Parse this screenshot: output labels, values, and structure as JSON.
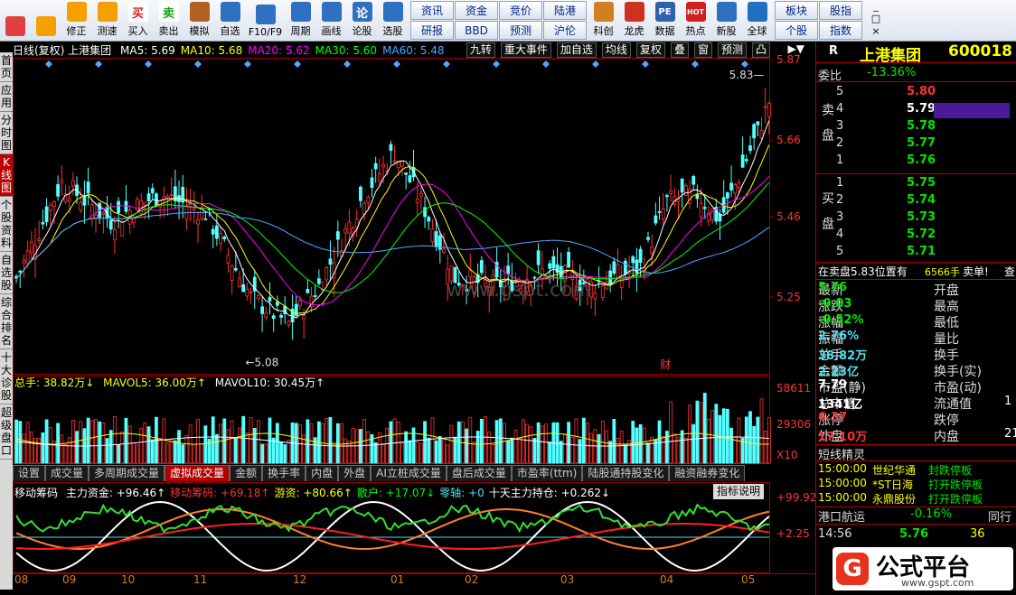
{
  "toolbar": {
    "buttons": [
      {
        "label": "",
        "icon": "grid-icon"
      },
      {
        "label": "",
        "icon": "back-arrow-icon"
      },
      {
        "label": "修正",
        "icon": "arrow-updown-icon"
      },
      {
        "label": "测速",
        "icon": "speed-icon"
      },
      {
        "label": "买入",
        "icon": "buy-icon",
        "glyph": "买"
      },
      {
        "label": "卖出",
        "icon": "sell-icon",
        "glyph": "卖"
      },
      {
        "label": "模拟",
        "icon": "hammer-icon"
      },
      {
        "label": "自选",
        "icon": "folder-icon"
      },
      {
        "label": "F10/F9",
        "icon": "f10-icon"
      },
      {
        "label": "周期",
        "icon": "clock-icon"
      },
      {
        "label": "画线",
        "icon": "pen-icon"
      },
      {
        "label": "论股",
        "icon": "talk-icon",
        "glyph": "论"
      },
      {
        "label": "选股",
        "icon": "search-chart-icon"
      }
    ],
    "grid": [
      [
        "资讯",
        "资金",
        "竞价",
        "陆港"
      ],
      [
        "研报",
        "BBD",
        "预测",
        "沪伦"
      ]
    ],
    "buttons2": [
      {
        "label": "科创",
        "icon": "star-chart-icon"
      },
      {
        "label": "龙虎",
        "icon": "dragon-icon"
      },
      {
        "label": "数据",
        "icon": "pe-icon",
        "glyph": "PE"
      },
      {
        "label": "热点",
        "icon": "hot-icon",
        "glyph": "HOT"
      },
      {
        "label": "新股",
        "icon": "new-stock-icon"
      },
      {
        "label": "全球",
        "icon": "globe-icon"
      }
    ],
    "grid2": [
      [
        "板块",
        "股指"
      ],
      [
        "个股",
        "指数"
      ]
    ],
    "window": [
      "_",
      "□",
      "×"
    ]
  },
  "left_tabs": [
    "首页",
    "应用",
    "分时图",
    "K线图",
    "个股资料",
    "自选股",
    "综合排名",
    "十大诊股",
    "超级盘口"
  ],
  "info": {
    "title": "日线(复权) 上港集团",
    "ma": [
      {
        "label": "MA5: 5.69",
        "color": "#ffffff"
      },
      {
        "label": "MA10: 5.68",
        "color": "#ffff00"
      },
      {
        "label": "MA20: 5.62",
        "color": "#ff00ff"
      },
      {
        "label": "MA30: 5.60",
        "color": "#00ff00"
      },
      {
        "label": "MA60: 5.48",
        "color": "#4ea8ff"
      }
    ],
    "buttons": [
      "九转",
      "重大事件",
      "加自选",
      "均线",
      "复权",
      "叠",
      "窗",
      "预测",
      "凸"
    ],
    "arrows": "▶▼"
  },
  "chart_data": {
    "type": "candlestick",
    "price_axis": [
      "5.87",
      "5.66",
      "5.46",
      "5.25"
    ],
    "price_range": [
      5.05,
      5.87
    ],
    "annotations": {
      "high": "5.83",
      "low": "5.08",
      "event": "财"
    },
    "volume_axis": [
      "58611",
      "29306",
      "X10"
    ],
    "indicator_axis": [
      "+99.92",
      "+2.25"
    ],
    "months": [
      "08",
      "09",
      "10",
      "11",
      "12",
      "01",
      "02",
      "03",
      "04",
      "05"
    ]
  },
  "volume": {
    "label": "总手: 38.82万↓",
    "mavol5": "MAVOL5: 36.00万↑",
    "mavol10": "MAVOL10: 30.45万↑"
  },
  "bottom_tabs": [
    "设置",
    "成交量",
    "多周期成交量",
    "虚拟成交量",
    "金额",
    "换手率",
    "内盘",
    "外盘",
    "AI立桩成交量",
    "盘后成交量",
    "市盈率(ttm)",
    "陆股通持股变化",
    "融资融券变化"
  ],
  "indicator": {
    "name": "移动筹码",
    "items": [
      {
        "t": "主力资金: +96.46↑",
        "c": "#ffffff"
      },
      {
        "t": "移动筹码: +69.18↑",
        "c": "#ff3030"
      },
      {
        "t": "游资: +80.66↑",
        "c": "#ffff00"
      },
      {
        "t": "散户: +17.07↓",
        "c": "#00ff00"
      },
      {
        "t": "零轴: +0",
        "c": "#4ee0f0"
      },
      {
        "t": "十天主力持仓: +0.262↓",
        "c": "#ffffff"
      }
    ],
    "help": "指标说明"
  },
  "right": {
    "r": "R",
    "name": "上港集团",
    "code": "600018",
    "weibi_label": "委比",
    "weibi": "-13.36%",
    "sell_label": "卖盘",
    "buy_label": "买盘",
    "sell": [
      {
        "n": "5",
        "p": "5.80",
        "c": "#ff3232"
      },
      {
        "n": "4",
        "p": "5.79",
        "c": "#ffffff"
      },
      {
        "n": "3",
        "p": "5.78",
        "c": "#00e600"
      },
      {
        "n": "2",
        "p": "5.77",
        "c": "#00e600"
      },
      {
        "n": "1",
        "p": "5.76",
        "c": "#00e600"
      }
    ],
    "buy": [
      {
        "n": "1",
        "p": "5.75",
        "c": "#00e600"
      },
      {
        "n": "2",
        "p": "5.74",
        "c": "#00e600"
      },
      {
        "n": "3",
        "p": "5.73",
        "c": "#00e600"
      },
      {
        "n": "4",
        "p": "5.72",
        "c": "#00e600"
      },
      {
        "n": "5",
        "p": "5.71",
        "c": "#00e600"
      }
    ],
    "notice": "在卖盘5.83位置有",
    "notice_vol": "6566手",
    "notice_end": "卖单!",
    "notice_tail": "查",
    "stats": [
      {
        "l": "最新",
        "v": "5.76",
        "vc": "#00e600",
        "l2": "开盘"
      },
      {
        "l": "涨跌",
        "v": "-0.03",
        "vc": "#00e600",
        "l2": "最高"
      },
      {
        "l": "涨幅",
        "v": "-0.52%",
        "vc": "#00e600",
        "l2": "最低"
      },
      {
        "l": "振幅",
        "v": "2.76%",
        "vc": "#4ee0f0",
        "l2": "量比"
      },
      {
        "l": "总手",
        "v": "38.82万",
        "vc": "#4ee0f0",
        "l2": "换手"
      },
      {
        "l": "金额",
        "v": "2.23亿",
        "vc": "#4ee0f0",
        "l2": "换手(实)"
      },
      {
        "l": "市盈(静)",
        "v": "7.79",
        "vc": "#ffffff",
        "l2": "市盈(动)"
      },
      {
        "l": "总市值",
        "v": "1341亿",
        "vc": "#ffffff",
        "l2": "流通值",
        "v2": "1"
      },
      {
        "l": "涨停",
        "v": "6.37",
        "vc": "#ff3232",
        "l2": "跌停"
      },
      {
        "l": "外盘",
        "v": "17.10万",
        "vc": "#ff3232",
        "l2": "内盘",
        "v2": "21"
      }
    ],
    "elf_title": "短线精灵",
    "elf": [
      {
        "t": "15:00:00",
        "n": "世纪华通",
        "e": "封跌停板",
        "ec": "#00e600"
      },
      {
        "t": "15:00:00",
        "n": "*ST日海",
        "e": "打开跌停板",
        "ec": "#00e600"
      },
      {
        "t": "15:00:00",
        "n": "永鼎股份",
        "e": "打开跌停板",
        "ec": "#00e600"
      }
    ],
    "hk_label": "港口航运",
    "hk_pct": "-0.16%",
    "hk_tail": "同行",
    "tick_time": "14:56",
    "tick_price": "5.76",
    "tick_vol": "36",
    "logo_text": "公式平台",
    "logo_url": "www.gspt.com"
  }
}
